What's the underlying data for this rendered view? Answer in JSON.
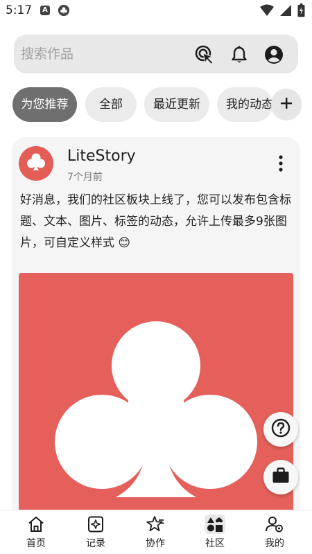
{
  "status_bar": {
    "time": "5:17",
    "app_badge": "A"
  },
  "search": {
    "placeholder": "搜索作品"
  },
  "chips": [
    {
      "label": "为您推荐",
      "active": true
    },
    {
      "label": "全部",
      "active": false
    },
    {
      "label": "最近更新",
      "active": false
    },
    {
      "label": "我的动态",
      "active": false
    }
  ],
  "post": {
    "author": "LiteStory",
    "time": "7个月前",
    "text": "好消息，我们的社区板块上线了，您可以发布包含标题、文本、图片、标签的动态，允许上传最多9张图片，可自定义样式 😊"
  },
  "bottom_nav": [
    {
      "label": "首页",
      "icon": "home-icon"
    },
    {
      "label": "记录",
      "icon": "record-icon"
    },
    {
      "label": "协作",
      "icon": "collab-icon"
    },
    {
      "label": "社区",
      "icon": "community-icon",
      "active": true
    },
    {
      "label": "我的",
      "icon": "profile-icon"
    }
  ],
  "colors": {
    "accent": "#e5605a",
    "chip_active": "#6f6f6f",
    "surface": "#f5f5f5"
  }
}
